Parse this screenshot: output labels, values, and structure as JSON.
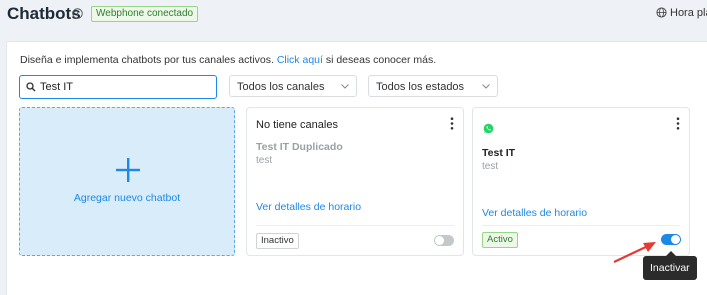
{
  "header": {
    "title": "Chatbots",
    "info_icon": "info-circle-icon",
    "connection_badge": "Webphone conectado",
    "timezone_label": "Hora pla",
    "timezone_icon": "globe-icon"
  },
  "intro": {
    "text_before": "Diseña e implementa chatbots por tus canales activos. ",
    "link": "Click aquí",
    "text_after": " si deseas conocer más."
  },
  "filters": {
    "search_value": "Test IT",
    "search_icon": "search-icon",
    "channel_select": "Todos los canales",
    "state_select": "Todos los estados"
  },
  "add_card": {
    "label": "Agregar nuevo chatbot",
    "icon": "plus-icon"
  },
  "chatbots": [
    {
      "channel_text": "No tiene canales",
      "name": "Test IT Duplicado",
      "description": "test",
      "schedule_link": "Ver detalles de horario",
      "status": "Inactivo",
      "enabled": false
    },
    {
      "channel_icon": "whatsapp-icon",
      "name": "Test IT",
      "description": "test",
      "schedule_link": "Ver detalles de horario",
      "status": "Activo",
      "enabled": true
    }
  ],
  "tooltip": "Inactivar",
  "colors": {
    "accent": "#1e88e5",
    "success": "#2e7d32",
    "annotation_arrow": "#e53935"
  }
}
